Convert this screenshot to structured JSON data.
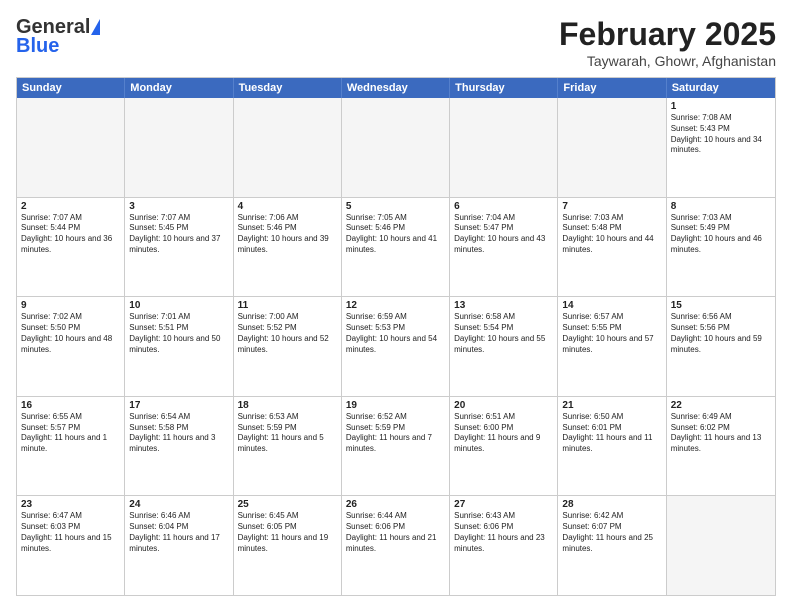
{
  "header": {
    "logo_general": "General",
    "logo_blue": "Blue",
    "month_title": "February 2025",
    "location": "Taywarah, Ghowr, Afghanistan"
  },
  "weekdays": [
    "Sunday",
    "Monday",
    "Tuesday",
    "Wednesday",
    "Thursday",
    "Friday",
    "Saturday"
  ],
  "rows": [
    [
      {
        "day": "",
        "text": "",
        "empty": true
      },
      {
        "day": "",
        "text": "",
        "empty": true
      },
      {
        "day": "",
        "text": "",
        "empty": true
      },
      {
        "day": "",
        "text": "",
        "empty": true
      },
      {
        "day": "",
        "text": "",
        "empty": true
      },
      {
        "day": "",
        "text": "",
        "empty": true
      },
      {
        "day": "1",
        "text": "Sunrise: 7:08 AM\nSunset: 5:43 PM\nDaylight: 10 hours and 34 minutes.",
        "empty": false
      }
    ],
    [
      {
        "day": "2",
        "text": "Sunrise: 7:07 AM\nSunset: 5:44 PM\nDaylight: 10 hours and 36 minutes.",
        "empty": false
      },
      {
        "day": "3",
        "text": "Sunrise: 7:07 AM\nSunset: 5:45 PM\nDaylight: 10 hours and 37 minutes.",
        "empty": false
      },
      {
        "day": "4",
        "text": "Sunrise: 7:06 AM\nSunset: 5:46 PM\nDaylight: 10 hours and 39 minutes.",
        "empty": false
      },
      {
        "day": "5",
        "text": "Sunrise: 7:05 AM\nSunset: 5:46 PM\nDaylight: 10 hours and 41 minutes.",
        "empty": false
      },
      {
        "day": "6",
        "text": "Sunrise: 7:04 AM\nSunset: 5:47 PM\nDaylight: 10 hours and 43 minutes.",
        "empty": false
      },
      {
        "day": "7",
        "text": "Sunrise: 7:03 AM\nSunset: 5:48 PM\nDaylight: 10 hours and 44 minutes.",
        "empty": false
      },
      {
        "day": "8",
        "text": "Sunrise: 7:03 AM\nSunset: 5:49 PM\nDaylight: 10 hours and 46 minutes.",
        "empty": false
      }
    ],
    [
      {
        "day": "9",
        "text": "Sunrise: 7:02 AM\nSunset: 5:50 PM\nDaylight: 10 hours and 48 minutes.",
        "empty": false
      },
      {
        "day": "10",
        "text": "Sunrise: 7:01 AM\nSunset: 5:51 PM\nDaylight: 10 hours and 50 minutes.",
        "empty": false
      },
      {
        "day": "11",
        "text": "Sunrise: 7:00 AM\nSunset: 5:52 PM\nDaylight: 10 hours and 52 minutes.",
        "empty": false
      },
      {
        "day": "12",
        "text": "Sunrise: 6:59 AM\nSunset: 5:53 PM\nDaylight: 10 hours and 54 minutes.",
        "empty": false
      },
      {
        "day": "13",
        "text": "Sunrise: 6:58 AM\nSunset: 5:54 PM\nDaylight: 10 hours and 55 minutes.",
        "empty": false
      },
      {
        "day": "14",
        "text": "Sunrise: 6:57 AM\nSunset: 5:55 PM\nDaylight: 10 hours and 57 minutes.",
        "empty": false
      },
      {
        "day": "15",
        "text": "Sunrise: 6:56 AM\nSunset: 5:56 PM\nDaylight: 10 hours and 59 minutes.",
        "empty": false
      }
    ],
    [
      {
        "day": "16",
        "text": "Sunrise: 6:55 AM\nSunset: 5:57 PM\nDaylight: 11 hours and 1 minute.",
        "empty": false
      },
      {
        "day": "17",
        "text": "Sunrise: 6:54 AM\nSunset: 5:58 PM\nDaylight: 11 hours and 3 minutes.",
        "empty": false
      },
      {
        "day": "18",
        "text": "Sunrise: 6:53 AM\nSunset: 5:59 PM\nDaylight: 11 hours and 5 minutes.",
        "empty": false
      },
      {
        "day": "19",
        "text": "Sunrise: 6:52 AM\nSunset: 5:59 PM\nDaylight: 11 hours and 7 minutes.",
        "empty": false
      },
      {
        "day": "20",
        "text": "Sunrise: 6:51 AM\nSunset: 6:00 PM\nDaylight: 11 hours and 9 minutes.",
        "empty": false
      },
      {
        "day": "21",
        "text": "Sunrise: 6:50 AM\nSunset: 6:01 PM\nDaylight: 11 hours and 11 minutes.",
        "empty": false
      },
      {
        "day": "22",
        "text": "Sunrise: 6:49 AM\nSunset: 6:02 PM\nDaylight: 11 hours and 13 minutes.",
        "empty": false
      }
    ],
    [
      {
        "day": "23",
        "text": "Sunrise: 6:47 AM\nSunset: 6:03 PM\nDaylight: 11 hours and 15 minutes.",
        "empty": false
      },
      {
        "day": "24",
        "text": "Sunrise: 6:46 AM\nSunset: 6:04 PM\nDaylight: 11 hours and 17 minutes.",
        "empty": false
      },
      {
        "day": "25",
        "text": "Sunrise: 6:45 AM\nSunset: 6:05 PM\nDaylight: 11 hours and 19 minutes.",
        "empty": false
      },
      {
        "day": "26",
        "text": "Sunrise: 6:44 AM\nSunset: 6:06 PM\nDaylight: 11 hours and 21 minutes.",
        "empty": false
      },
      {
        "day": "27",
        "text": "Sunrise: 6:43 AM\nSunset: 6:06 PM\nDaylight: 11 hours and 23 minutes.",
        "empty": false
      },
      {
        "day": "28",
        "text": "Sunrise: 6:42 AM\nSunset: 6:07 PM\nDaylight: 11 hours and 25 minutes.",
        "empty": false
      },
      {
        "day": "",
        "text": "",
        "empty": true
      }
    ]
  ]
}
